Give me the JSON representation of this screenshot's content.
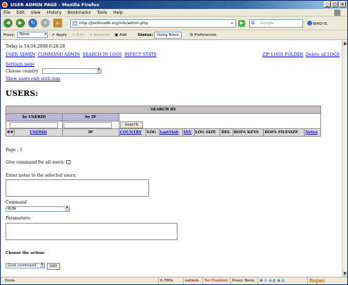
{
  "window": {
    "title": "USER ADMIN PAGE - Mozilla Firefox"
  },
  "menu": [
    "File",
    "Edit",
    "View",
    "History",
    "Bookmarks",
    "Tools",
    "Help"
  ],
  "nav": {
    "url": "http://joshhcodb.org/info/admin.php",
    "search_placeholder": "Google",
    "whois_label": "WHO IS"
  },
  "extbar": {
    "proxy_label": "Proxy:",
    "proxy_value": "None",
    "apply": "Apply",
    "edit": "Edit",
    "remove": "Remove",
    "add": "Add",
    "status_label": "Status:",
    "status_value": "Using None",
    "preferences": "Preferences"
  },
  "page": {
    "date_line": "Today is 14.04.2008 6:28:28",
    "topnav": [
      "USER ADMIN",
      "COMMAND ADMIN",
      "SEARCH IN LOGS",
      "INFECT STATS"
    ],
    "topnav_right": [
      "ZIP LOGS FOLDER",
      "Delete all LOGS"
    ],
    "settings_link": "Settings page",
    "choose_country_label": "Choose country",
    "show_users_link": "Show users only with logs",
    "heading": "USERS:",
    "search_by": "SEARCH BY",
    "by_userid": "by USERID",
    "by_ip": "by IP",
    "search_button": "Search",
    "columns": {
      "num": "##",
      "userid": "USERID",
      "ip": "IP",
      "country": "COUNTRY",
      "log": "LOG",
      "lastvisit": "LastVisit",
      "inv": "INV",
      "logsize": "LOG SIZE",
      "del": "DEL",
      "bofa_keys": "BOFA KEYS",
      "bofa_filesize": "BOFA FILESIZE",
      "notes": "Notes"
    },
    "page_label": "Page : 1",
    "give_all_label": "Give command for all users:",
    "notes_label": "Enter notes to the selected users:",
    "command_label": "Command",
    "command_value": "RUN",
    "parameters_label": "Parameters:",
    "choose_action_label": "Choose the action:",
    "action_value": "Give command",
    "go_button": "GO!"
  },
  "statusbar": {
    "done": "Done",
    "timing": "0.780s",
    "zotero": "zotero",
    "tor": "Tor Disabled",
    "proxy": "Proxy: None",
    "finjan": "finjan"
  }
}
